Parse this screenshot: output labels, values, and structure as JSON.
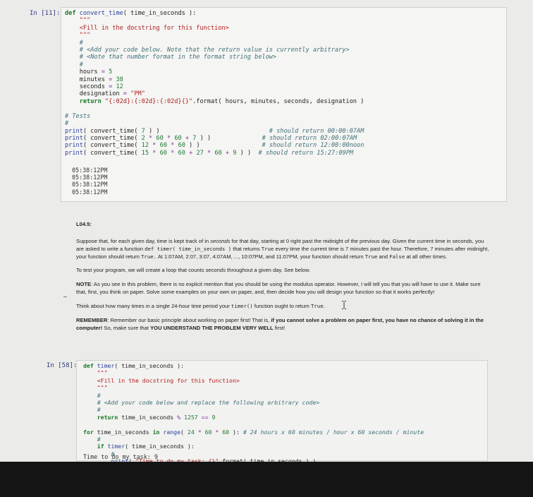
{
  "cell1": {
    "prompt": "In [11]:",
    "lines": [
      {
        "parts": [
          {
            "t": "def ",
            "c": "kw"
          },
          {
            "t": "convert_time",
            "c": "fn"
          },
          {
            "t": "( time_in_seconds ):"
          }
        ]
      },
      {
        "parts": [
          {
            "t": "    \"\"\"",
            "c": "str"
          }
        ]
      },
      {
        "parts": [
          {
            "t": "    <Fill in the docstring for this function>",
            "c": "str"
          }
        ]
      },
      {
        "parts": [
          {
            "t": "    \"\"\"",
            "c": "str"
          }
        ]
      },
      {
        "parts": [
          {
            "t": "    #",
            "c": "cm"
          }
        ]
      },
      {
        "parts": [
          {
            "t": "    # <Add your code below. Note that the return value is currently arbitrary>",
            "c": "cm"
          }
        ]
      },
      {
        "parts": [
          {
            "t": "    # <Note that number format in the format string below>",
            "c": "cm"
          }
        ]
      },
      {
        "parts": [
          {
            "t": "    #",
            "c": "cm"
          }
        ]
      },
      {
        "parts": [
          {
            "t": "    hours "
          },
          {
            "t": "=",
            "c": "op"
          },
          {
            "t": " "
          },
          {
            "t": "5",
            "c": "num"
          }
        ]
      },
      {
        "parts": [
          {
            "t": "    minutes "
          },
          {
            "t": "=",
            "c": "op"
          },
          {
            "t": " "
          },
          {
            "t": "38",
            "c": "num"
          }
        ]
      },
      {
        "parts": [
          {
            "t": "    seconds "
          },
          {
            "t": "=",
            "c": "op"
          },
          {
            "t": " "
          },
          {
            "t": "12",
            "c": "num"
          }
        ]
      },
      {
        "parts": [
          {
            "t": "    designation "
          },
          {
            "t": "=",
            "c": "op"
          },
          {
            "t": " "
          },
          {
            "t": "\"PM\"",
            "c": "str"
          }
        ]
      },
      {
        "parts": [
          {
            "t": "    "
          },
          {
            "t": "return ",
            "c": "kw"
          },
          {
            "t": "\"{:02d}:{:02d}:{:02d}{}\"",
            "c": "str"
          },
          {
            "t": ".format( hours, minutes, seconds, designation )"
          }
        ]
      },
      {
        "parts": [
          {
            "t": ""
          }
        ]
      },
      {
        "parts": [
          {
            "t": "# Tests",
            "c": "cm"
          }
        ]
      },
      {
        "parts": [
          {
            "t": "#",
            "c": "cm"
          }
        ]
      },
      {
        "parts": [
          {
            "t": "print",
            "c": "fn"
          },
          {
            "t": "( convert_time( "
          },
          {
            "t": "7",
            "c": "num"
          },
          {
            "t": " ) )                              "
          },
          {
            "t": "# should return 00:00:07AM",
            "c": "cm"
          }
        ]
      },
      {
        "parts": [
          {
            "t": "print",
            "c": "fn"
          },
          {
            "t": "( convert_time( "
          },
          {
            "t": "2",
            "c": "num"
          },
          {
            "t": " "
          },
          {
            "t": "*",
            "c": "op"
          },
          {
            "t": " "
          },
          {
            "t": "60",
            "c": "num"
          },
          {
            "t": " "
          },
          {
            "t": "*",
            "c": "op"
          },
          {
            "t": " "
          },
          {
            "t": "60",
            "c": "num"
          },
          {
            "t": " "
          },
          {
            "t": "+",
            "c": "op"
          },
          {
            "t": " "
          },
          {
            "t": "7",
            "c": "num"
          },
          {
            "t": " ) )              "
          },
          {
            "t": "# should return 02:00:07AM",
            "c": "cm"
          }
        ]
      },
      {
        "parts": [
          {
            "t": "print",
            "c": "fn"
          },
          {
            "t": "( convert_time( "
          },
          {
            "t": "12",
            "c": "num"
          },
          {
            "t": " "
          },
          {
            "t": "*",
            "c": "op"
          },
          {
            "t": " "
          },
          {
            "t": "60",
            "c": "num"
          },
          {
            "t": " "
          },
          {
            "t": "*",
            "c": "op"
          },
          {
            "t": " "
          },
          {
            "t": "60",
            "c": "num"
          },
          {
            "t": " ) )                 "
          },
          {
            "t": "# should return 12:00:00noon",
            "c": "cm"
          }
        ]
      },
      {
        "parts": [
          {
            "t": "print",
            "c": "fn"
          },
          {
            "t": "( convert_time( "
          },
          {
            "t": "15",
            "c": "num"
          },
          {
            "t": " "
          },
          {
            "t": "*",
            "c": "op"
          },
          {
            "t": " "
          },
          {
            "t": "60",
            "c": "num"
          },
          {
            "t": " "
          },
          {
            "t": "*",
            "c": "op"
          },
          {
            "t": " "
          },
          {
            "t": "60",
            "c": "num"
          },
          {
            "t": " "
          },
          {
            "t": "+",
            "c": "op"
          },
          {
            "t": " "
          },
          {
            "t": "27",
            "c": "num"
          },
          {
            "t": " "
          },
          {
            "t": "*",
            "c": "op"
          },
          {
            "t": " "
          },
          {
            "t": "60",
            "c": "num"
          },
          {
            "t": " "
          },
          {
            "t": "+",
            "c": "op"
          },
          {
            "t": " "
          },
          {
            "t": "9",
            "c": "num"
          },
          {
            "t": " ) )  "
          },
          {
            "t": "# should return 15:27:09PM",
            "c": "cm"
          }
        ]
      }
    ],
    "output": [
      "05:38:12PM",
      "05:38:12PM",
      "05:38:12PM",
      "05:38:12PM"
    ]
  },
  "markdown": {
    "heading": "L04.5:",
    "p1": [
      {
        "t": "Suppose that, for each given day, time is kept track of in "
      },
      {
        "t": "seconds",
        "i": true
      },
      {
        "t": " for that day, starting at 0 right past the midnight of the previous day. Given the current time in seconds, you are asked to write a function "
      },
      {
        "t": "def timer( time_in_seconds )",
        "code": true
      },
      {
        "t": " that returns "
      },
      {
        "t": "True",
        "code": true
      },
      {
        "t": " every time the current time is 7 minutes past the hour. Therefore, 7 minutes after midnight, your function should return "
      },
      {
        "t": "True.",
        "code": true
      },
      {
        "t": " At 1:07AM, 2:07, 3:07, 4:07AM, ..., 10:07PM, and 11:07PM, your function should return "
      },
      {
        "t": "True",
        "code": true
      },
      {
        "t": " and "
      },
      {
        "t": "False",
        "code": true
      },
      {
        "t": " at all other times."
      }
    ],
    "p2": "To test your program, we will create a loop that counts seconds throughout a given day. See below.",
    "p3": [
      {
        "t": "NOTE",
        "b": true
      },
      {
        "t": ": As you see in this problem, there is no explicit mention that you should be using the modulus operator. However, I will tell you that you will have to use it. Make sure that, first, you think on paper. Solve some examples on your own on paper, and, then decide how you will design your function so that it works perfectly!"
      }
    ],
    "p4": [
      {
        "t": "Think about how many times in a single 24-hour time period your "
      },
      {
        "t": "timer()",
        "code": true
      },
      {
        "t": " function ought to return "
      },
      {
        "t": "True",
        "code": true
      },
      {
        "t": "."
      }
    ],
    "p5": [
      {
        "t": "REMEMBER",
        "b": true
      },
      {
        "t": ": Remember our basic principle about working on paper first! That is, "
      },
      {
        "t": "if you cannot solve a problem on paper first, you have no chance of solving it in the computer!",
        "b": true
      },
      {
        "t": " So, make sure that "
      },
      {
        "t": "YOU UNDERSTAND THE PROBLEM VERY WELL",
        "b": true
      },
      {
        "t": " first!"
      }
    ]
  },
  "cell2": {
    "prompt": "In [58]:",
    "lines": [
      {
        "parts": [
          {
            "t": "def ",
            "c": "kw"
          },
          {
            "t": "timer",
            "c": "fn"
          },
          {
            "t": "( time_in_seconds ):"
          }
        ]
      },
      {
        "parts": [
          {
            "t": "    \"\"\"",
            "c": "str"
          }
        ]
      },
      {
        "parts": [
          {
            "t": "    <Fill in the docstring for this function>",
            "c": "str"
          }
        ]
      },
      {
        "parts": [
          {
            "t": "    \"\"\"",
            "c": "str"
          }
        ]
      },
      {
        "parts": [
          {
            "t": "    #",
            "c": "cm"
          }
        ]
      },
      {
        "parts": [
          {
            "t": "    # <Add your code below and replace the following arbitrary code>",
            "c": "cm"
          }
        ]
      },
      {
        "parts": [
          {
            "t": "    #",
            "c": "cm"
          }
        ]
      },
      {
        "parts": [
          {
            "t": "    "
          },
          {
            "t": "return ",
            "c": "kw"
          },
          {
            "t": "time_in_seconds "
          },
          {
            "t": "%",
            "c": "op"
          },
          {
            "t": " "
          },
          {
            "t": "1257",
            "c": "num"
          },
          {
            "t": " "
          },
          {
            "t": "==",
            "c": "op"
          },
          {
            "t": " "
          },
          {
            "t": "9",
            "c": "num"
          }
        ]
      },
      {
        "parts": [
          {
            "t": ""
          }
        ]
      },
      {
        "parts": [
          {
            "t": "for ",
            "c": "kw"
          },
          {
            "t": "time_in_seconds "
          },
          {
            "t": "in ",
            "c": "kw"
          },
          {
            "t": "range",
            "c": "fn"
          },
          {
            "t": "( "
          },
          {
            "t": "24",
            "c": "num"
          },
          {
            "t": " "
          },
          {
            "t": "*",
            "c": "op"
          },
          {
            "t": " "
          },
          {
            "t": "60",
            "c": "num"
          },
          {
            "t": " "
          },
          {
            "t": "*",
            "c": "op"
          },
          {
            "t": " "
          },
          {
            "t": "60",
            "c": "num"
          },
          {
            "t": " ): "
          },
          {
            "t": "# 24 hours x 60 minutes / hour x 60 seconds / minute",
            "c": "cm"
          }
        ]
      },
      {
        "parts": [
          {
            "t": "    #",
            "c": "cm"
          }
        ]
      },
      {
        "parts": [
          {
            "t": "    "
          },
          {
            "t": "if ",
            "c": "kw"
          },
          {
            "t": "timer",
            "c": "fn"
          },
          {
            "t": "( time_in_seconds ):"
          }
        ]
      },
      {
        "parts": [
          {
            "t": "        #",
            "c": "cm"
          }
        ]
      },
      {
        "parts": [
          {
            "t": "        "
          },
          {
            "t": "print",
            "c": "fn"
          },
          {
            "t": "( "
          },
          {
            "t": "\"Time to do my task: {}\"",
            "c": "str"
          },
          {
            "t": ".format( time_in_seconds ) )"
          }
        ]
      }
    ],
    "output": [
      "Time to do my task: 9"
    ]
  },
  "colors": {
    "keyword": "#1a7a27",
    "string": "#b02020",
    "comment": "#3f6f79",
    "number": "#1e7a32",
    "prompt": "#2f3a80"
  },
  "icons": [
    "text-cursor-icon",
    "dash-marker-icon"
  ]
}
